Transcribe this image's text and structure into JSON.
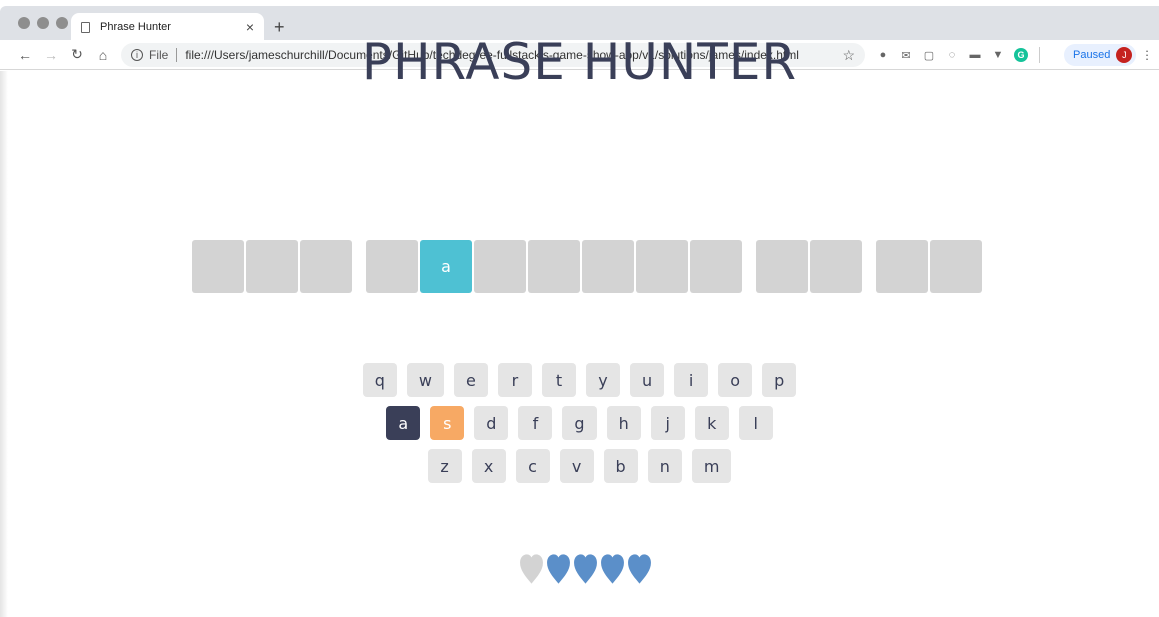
{
  "browser": {
    "tab_title": "Phrase Hunter",
    "tab_close": "×",
    "new_tab": "+",
    "url_scheme": "File",
    "url": "file:///Users/jameschurchill/Documents/GitHub/techdegree-fullstackjs-game-show-app/v1/solutions/james/index.html",
    "profile_label": "Paused",
    "profile_initial": "J"
  },
  "game": {
    "title": "PHRASE HUNTER",
    "phrase_words": [
      [
        {
          "ch": ""
        },
        {
          "ch": ""
        },
        {
          "ch": ""
        }
      ],
      [
        {
          "ch": ""
        },
        {
          "ch": "a",
          "shown": true
        },
        {
          "ch": ""
        },
        {
          "ch": ""
        },
        {
          "ch": ""
        },
        {
          "ch": ""
        },
        {
          "ch": ""
        }
      ],
      [
        {
          "ch": ""
        },
        {
          "ch": ""
        }
      ],
      [
        {
          "ch": ""
        },
        {
          "ch": ""
        }
      ]
    ],
    "keyboard_rows": [
      [
        "q",
        "w",
        "e",
        "r",
        "t",
        "y",
        "u",
        "i",
        "o",
        "p"
      ],
      [
        "a",
        "s",
        "d",
        "f",
        "g",
        "h",
        "j",
        "k",
        "l"
      ],
      [
        "z",
        "x",
        "c",
        "v",
        "b",
        "n",
        "m"
      ]
    ],
    "chosen_keys": [
      "a"
    ],
    "wrong_keys": [
      "s"
    ],
    "lives_total": 5,
    "lives_lost": 1,
    "colors": {
      "title": "#3a3f58",
      "tile_hidden": "#d3d3d3",
      "tile_shown": "#4ec1d3",
      "key_default": "#e5e5e5",
      "key_chosen": "#3a3f58",
      "key_wrong": "#f7a964",
      "heart_live": "#5b8fc9",
      "heart_lost": "#d3d3d3"
    }
  }
}
